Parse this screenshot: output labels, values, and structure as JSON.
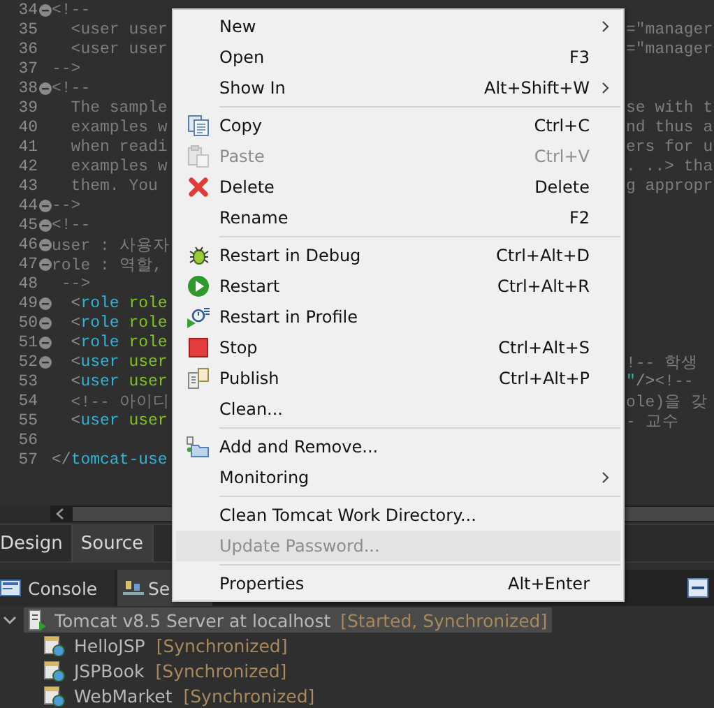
{
  "editor": {
    "lines": [
      {
        "number": "34",
        "fold": true,
        "left": [
          {
            "kind": "comment",
            "text": "<!--"
          }
        ]
      },
      {
        "number": "35",
        "left": [
          {
            "kind": "comment",
            "text": "  <user user"
          }
        ],
        "right": [
          {
            "kind": "comment",
            "text": "=\"manager"
          }
        ]
      },
      {
        "number": "36",
        "left": [
          {
            "kind": "comment",
            "text": "  <user user"
          }
        ],
        "right": [
          {
            "kind": "comment",
            "text": "=\"manager"
          }
        ]
      },
      {
        "number": "37",
        "left": [
          {
            "kind": "comment",
            "text": "-->"
          }
        ]
      },
      {
        "number": "38",
        "fold": true,
        "left": [
          {
            "kind": "comment",
            "text": "<!--"
          }
        ]
      },
      {
        "number": "39",
        "left": [
          {
            "kind": "comment",
            "text": "  The sample"
          }
        ],
        "right": [
          {
            "kind": "comment",
            "text": "se with t"
          }
        ]
      },
      {
        "number": "40",
        "left": [
          {
            "kind": "comment",
            "text": "  examples w"
          }
        ],
        "right": [
          {
            "kind": "comment",
            "text": "nd thus a"
          }
        ]
      },
      {
        "number": "41",
        "left": [
          {
            "kind": "comment",
            "text": "  when readi"
          }
        ],
        "right": [
          {
            "kind": "comment",
            "text": "ers for u"
          }
        ]
      },
      {
        "number": "42",
        "left": [
          {
            "kind": "comment",
            "text": "  examples w"
          }
        ],
        "right": [
          {
            "kind": "comment",
            "text": ". ..> tha"
          }
        ]
      },
      {
        "number": "43",
        "left": [
          {
            "kind": "comment",
            "text": "  them. You "
          }
        ],
        "right": [
          {
            "kind": "comment",
            "text": "g appropr"
          }
        ]
      },
      {
        "number": "44",
        "fold": true,
        "left": [
          {
            "kind": "comment",
            "text": "-->"
          }
        ]
      },
      {
        "number": "45",
        "fold": true,
        "left": [
          {
            "kind": "comment",
            "text": "<!--"
          }
        ]
      },
      {
        "number": "46",
        "fold": true,
        "left": [
          {
            "kind": "comment",
            "text": "user : 사용자"
          }
        ]
      },
      {
        "number": "47",
        "fold": true,
        "left": [
          {
            "kind": "comment",
            "text": "role : 역할,"
          }
        ]
      },
      {
        "number": "48",
        "left": [
          {
            "kind": "comment",
            "text": " -->"
          }
        ]
      },
      {
        "number": "49",
        "fold": true,
        "left": [
          {
            "kind": "punct",
            "text": "  <"
          },
          {
            "kind": "tag",
            "text": "role"
          },
          {
            "kind": "attr",
            "text": " role"
          }
        ]
      },
      {
        "number": "50",
        "fold": true,
        "left": [
          {
            "kind": "punct",
            "text": "  <"
          },
          {
            "kind": "tag",
            "text": "role"
          },
          {
            "kind": "attr",
            "text": " role"
          }
        ]
      },
      {
        "number": "51",
        "fold": true,
        "left": [
          {
            "kind": "punct",
            "text": "  <"
          },
          {
            "kind": "tag",
            "text": "role"
          },
          {
            "kind": "attr",
            "text": " role"
          }
        ]
      },
      {
        "number": "52",
        "fold": true,
        "left": [
          {
            "kind": "punct",
            "text": "  <"
          },
          {
            "kind": "tag",
            "text": "user"
          },
          {
            "kind": "attr",
            "text": " user"
          }
        ],
        "right": [
          {
            "kind": "comment",
            "text": "!-- 학생"
          }
        ]
      },
      {
        "number": "53",
        "left": [
          {
            "kind": "punct",
            "text": "  <"
          },
          {
            "kind": "tag",
            "text": "user"
          },
          {
            "kind": "attr",
            "text": " user"
          }
        ],
        "right": [
          {
            "kind": "string",
            "text": "\""
          },
          {
            "kind": "punct",
            "text": "/>"
          },
          {
            "kind": "comment",
            "text": "<!--"
          }
        ]
      },
      {
        "number": "54",
        "left": [
          {
            "kind": "comment",
            "text": "  <!-- 아이디"
          }
        ],
        "right": [
          {
            "kind": "comment",
            "text": "ole)을 갖"
          }
        ]
      },
      {
        "number": "55",
        "left": [
          {
            "kind": "punct",
            "text": "  <"
          },
          {
            "kind": "tag",
            "text": "user"
          },
          {
            "kind": "attr",
            "text": " user"
          }
        ],
        "right": [
          {
            "kind": "comment",
            "text": "- 교수"
          }
        ]
      },
      {
        "number": "56"
      },
      {
        "number": "57",
        "left": [
          {
            "kind": "punct",
            "text": "</"
          },
          {
            "kind": "tag",
            "text": "tomcat-use"
          }
        ]
      }
    ]
  },
  "editor_tabs": [
    {
      "label": "Design",
      "selected": false
    },
    {
      "label": "Source",
      "selected": true
    }
  ],
  "view_tabs": [
    {
      "label": "Console",
      "kind": "console",
      "selected": false
    },
    {
      "label": "Se",
      "kind": "servers",
      "selected": true
    }
  ],
  "servers": [
    {
      "name": "Tomcat v8.5 Server at localhost",
      "status": "[Started, Synchronized]",
      "expanded": true,
      "selected": true,
      "children": [
        {
          "name": "HelloJSP",
          "status": "[Synchronized]"
        },
        {
          "name": "JSPBook",
          "status": "[Synchronized]"
        },
        {
          "name": "WebMarket",
          "status": "[Synchronized]"
        }
      ]
    }
  ],
  "context_menu": [
    {
      "kind": "plain",
      "label": "New",
      "submenu": true,
      "disabled": false,
      "selected": false
    },
    {
      "kind": "plain",
      "label": "Open",
      "shortcut": "F3",
      "submenu": false,
      "disabled": false,
      "selected": false
    },
    {
      "kind": "plain",
      "label": "Show In",
      "shortcut": "Alt+Shift+W",
      "submenu": true,
      "disabled": false,
      "selected": false
    },
    {
      "kind": "separator"
    },
    {
      "kind": "copy",
      "label": "Copy",
      "shortcut": "Ctrl+C",
      "submenu": false,
      "disabled": false,
      "selected": false
    },
    {
      "kind": "paste",
      "label": "Paste",
      "shortcut": "Ctrl+V",
      "submenu": false,
      "disabled": true,
      "selected": false
    },
    {
      "kind": "delete",
      "label": "Delete",
      "shortcut": "Delete",
      "submenu": false,
      "disabled": false,
      "selected": false
    },
    {
      "kind": "plain",
      "label": "Rename",
      "shortcut": "F2",
      "submenu": false,
      "disabled": false,
      "selected": false
    },
    {
      "kind": "separator"
    },
    {
      "kind": "debug",
      "label": "Restart in Debug",
      "shortcut": "Ctrl+Alt+D",
      "submenu": false,
      "disabled": false,
      "selected": false
    },
    {
      "kind": "restart",
      "label": "Restart",
      "shortcut": "Ctrl+Alt+R",
      "submenu": false,
      "disabled": false,
      "selected": false
    },
    {
      "kind": "profile",
      "label": "Restart in Profile",
      "submenu": false,
      "disabled": false,
      "selected": false
    },
    {
      "kind": "stop",
      "label": "Stop",
      "shortcut": "Ctrl+Alt+S",
      "submenu": false,
      "disabled": false,
      "selected": false
    },
    {
      "kind": "publish",
      "label": "Publish",
      "shortcut": "Ctrl+Alt+P",
      "submenu": false,
      "disabled": false,
      "selected": false
    },
    {
      "kind": "plain",
      "label": "Clean...",
      "submenu": false,
      "disabled": false,
      "selected": false
    },
    {
      "kind": "separator"
    },
    {
      "kind": "addremove",
      "label": "Add and Remove...",
      "submenu": false,
      "disabled": false,
      "selected": false
    },
    {
      "kind": "plain",
      "label": "Monitoring",
      "submenu": true,
      "disabled": false,
      "selected": false
    },
    {
      "kind": "separator"
    },
    {
      "kind": "plain",
      "label": "Clean Tomcat Work Directory...",
      "submenu": false,
      "disabled": false,
      "selected": false
    },
    {
      "kind": "plain",
      "label": "Update Password...",
      "submenu": false,
      "disabled": true,
      "selected": true
    },
    {
      "kind": "separator"
    },
    {
      "kind": "plain",
      "label": "Properties",
      "shortcut": "Alt+Enter",
      "submenu": false,
      "disabled": false,
      "selected": false
    }
  ]
}
